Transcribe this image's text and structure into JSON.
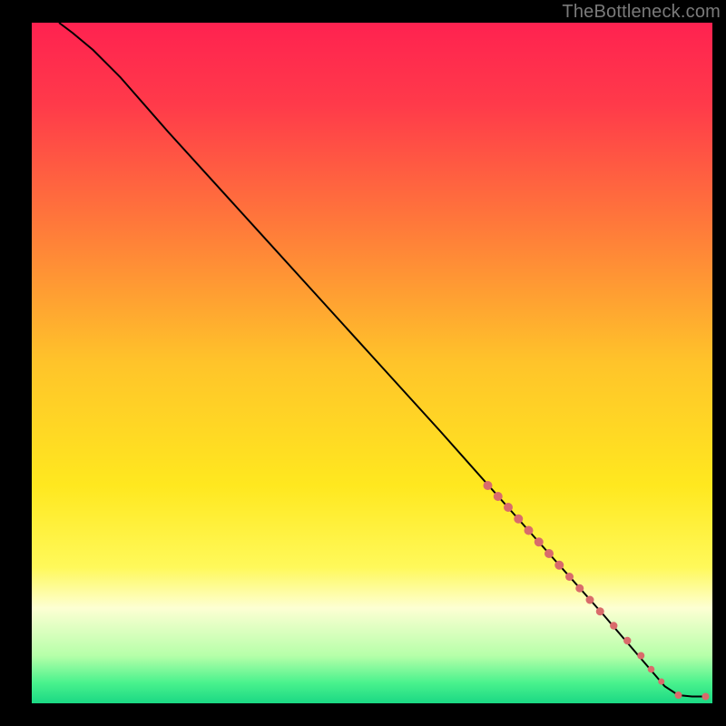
{
  "watermark": "TheBottleneck.com",
  "chart_data": {
    "type": "line",
    "title": "",
    "xlabel": "",
    "ylabel": "",
    "xlim": [
      0,
      100
    ],
    "ylim": [
      0,
      100
    ],
    "axes_visible": false,
    "grid": false,
    "background_gradient_stops": [
      {
        "pct": 0,
        "color": "#ff2250"
      },
      {
        "pct": 12,
        "color": "#ff3a4a"
      },
      {
        "pct": 30,
        "color": "#ff7a3a"
      },
      {
        "pct": 50,
        "color": "#ffc42a"
      },
      {
        "pct": 68,
        "color": "#ffe81f"
      },
      {
        "pct": 80,
        "color": "#fff95a"
      },
      {
        "pct": 86,
        "color": "#fdffd3"
      },
      {
        "pct": 93,
        "color": "#b6ffa9"
      },
      {
        "pct": 97,
        "color": "#49f28d"
      },
      {
        "pct": 100,
        "color": "#1bd884"
      }
    ],
    "curve": {
      "_comment": "Approximate bottleneck curve. x is horizontal position (0=left edge of plot, 100=right), y is value (0=bottom, 100=top). Curve starts at top-left, descends nearly linearly, then flattens near bottom-right.",
      "points": [
        {
          "x": 4,
          "y": 100
        },
        {
          "x": 6,
          "y": 98.5
        },
        {
          "x": 9,
          "y": 96
        },
        {
          "x": 13,
          "y": 92
        },
        {
          "x": 20,
          "y": 84
        },
        {
          "x": 30,
          "y": 73
        },
        {
          "x": 40,
          "y": 62
        },
        {
          "x": 50,
          "y": 51
        },
        {
          "x": 60,
          "y": 40
        },
        {
          "x": 68,
          "y": 31
        },
        {
          "x": 76,
          "y": 22
        },
        {
          "x": 84,
          "y": 13
        },
        {
          "x": 90,
          "y": 6
        },
        {
          "x": 93,
          "y": 2.5
        },
        {
          "x": 95,
          "y": 1.2
        },
        {
          "x": 97,
          "y": 1.0
        },
        {
          "x": 99,
          "y": 1.0
        }
      ]
    },
    "markers": {
      "_comment": "Reddish dot markers highlighting sampled points along the lower-right portion of the curve.",
      "color": "#d96b6b",
      "points": [
        {
          "x": 67,
          "y": 32,
          "r": 5
        },
        {
          "x": 68.5,
          "y": 30.4,
          "r": 5
        },
        {
          "x": 70,
          "y": 28.8,
          "r": 5
        },
        {
          "x": 71.5,
          "y": 27.1,
          "r": 5
        },
        {
          "x": 73,
          "y": 25.4,
          "r": 5
        },
        {
          "x": 74.5,
          "y": 23.7,
          "r": 5
        },
        {
          "x": 76,
          "y": 22.0,
          "r": 5
        },
        {
          "x": 77.5,
          "y": 20.3,
          "r": 5
        },
        {
          "x": 79,
          "y": 18.6,
          "r": 4.5
        },
        {
          "x": 80.5,
          "y": 16.9,
          "r": 4.5
        },
        {
          "x": 82,
          "y": 15.2,
          "r": 4.5
        },
        {
          "x": 83.5,
          "y": 13.5,
          "r": 4.5
        },
        {
          "x": 85.5,
          "y": 11.4,
          "r": 4.2
        },
        {
          "x": 87.5,
          "y": 9.2,
          "r": 4.2
        },
        {
          "x": 89.5,
          "y": 7.0,
          "r": 4.0
        },
        {
          "x": 91,
          "y": 5.0,
          "r": 3.8
        },
        {
          "x": 92.5,
          "y": 3.2,
          "r": 3.5
        },
        {
          "x": 95,
          "y": 1.2,
          "r": 4.0
        },
        {
          "x": 99,
          "y": 1.0,
          "r": 4.0
        }
      ]
    }
  }
}
